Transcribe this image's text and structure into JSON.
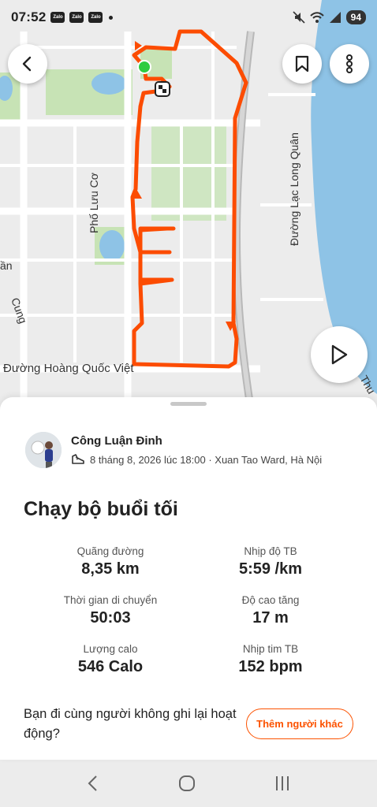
{
  "status_bar": {
    "time": "07:52",
    "notification_apps": [
      "Zalo",
      "Zalo",
      "Zalo"
    ],
    "battery": "94"
  },
  "map": {
    "labels": {
      "street_hoang_quoc_viet": "Đường Hoàng Quốc Việt",
      "street_lac_long_quan": "Đường Lạc Long Quân",
      "street_luu_co": "Phố Lưu Cơ",
      "street_cung": "Cung",
      "street_an": "ần",
      "street_thu": "Thu"
    },
    "route_color": "#fc4c02",
    "start_color": "#2ecc40"
  },
  "activity": {
    "athlete_name": "Công Luận Đinh",
    "meta": "8 tháng 8, 2026 lúc 18:00 · Xuan Tao Ward, Hà Nội",
    "title": "Chạy bộ buổi tối",
    "stats": [
      {
        "label": "Quãng đường",
        "value": "8,35 km"
      },
      {
        "label": "Nhịp độ TB",
        "value": "5:59 /km"
      },
      {
        "label": "Thời gian di chuyển",
        "value": "50:03"
      },
      {
        "label": "Độ cao tăng",
        "value": "17 m"
      },
      {
        "label": "Lượng calo",
        "value": "546 Calo"
      },
      {
        "label": "Nhịp tim TB",
        "value": "152 bpm"
      }
    ],
    "companion_prompt": "Bạn đi cùng người không ghi lại hoạt động?",
    "add_button_label": "Thêm người khác"
  },
  "colors": {
    "accent": "#fc5200",
    "water": "#8ec3e6",
    "park": "#c7e3b5"
  }
}
